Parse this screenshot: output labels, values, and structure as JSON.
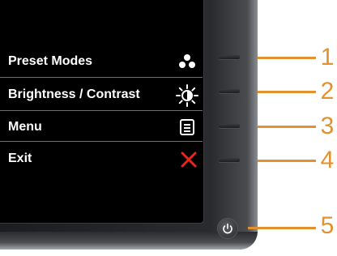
{
  "menu": {
    "items": [
      {
        "label": "Preset Modes",
        "icon": "preset-modes-icon"
      },
      {
        "label": "Brightness / Contrast",
        "icon": "brightness-icon"
      },
      {
        "label": "Menu",
        "icon": "menu-icon"
      },
      {
        "label": "Exit",
        "icon": "close-icon"
      }
    ]
  },
  "callouts": [
    "1",
    "2",
    "3",
    "4",
    "5"
  ],
  "colors": {
    "callout": "#e2912e",
    "exit_icon": "#e8251e",
    "text": "#ffffff"
  }
}
